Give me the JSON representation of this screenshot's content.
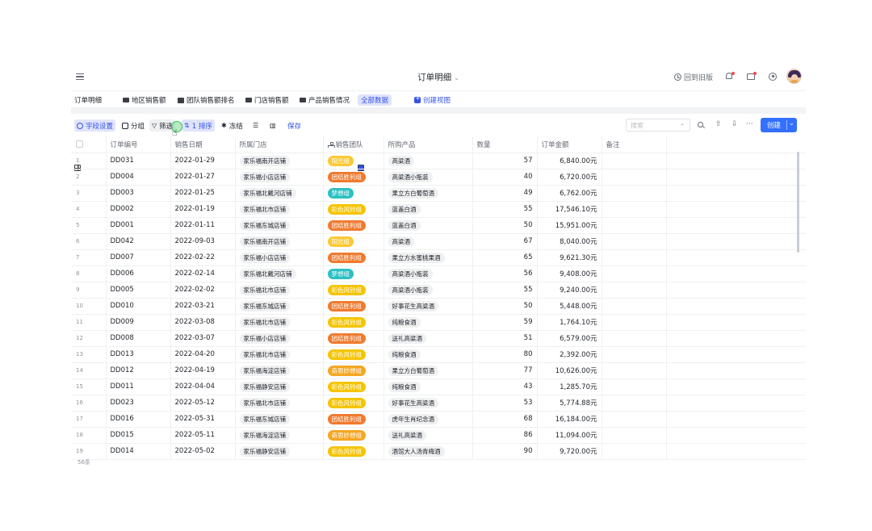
{
  "topbar": {
    "title": "订单明细",
    "title_chevron": "⌄",
    "back_old": "回到旧版"
  },
  "tabs": [
    {
      "label": "订单明细",
      "icon": "grid-table-icon"
    },
    {
      "label": "地区销售额",
      "icon": "folder-icon"
    },
    {
      "label": "团队销售额排名",
      "icon": "table-icon"
    },
    {
      "label": "门店销售额",
      "icon": "folder-icon"
    },
    {
      "label": "产品销售情况",
      "icon": "folder-icon"
    },
    {
      "label": "全部数据",
      "icon": "grid-view-icon",
      "active": true
    },
    {
      "label": "创建视图",
      "icon": "plus-icon"
    }
  ],
  "toolbar": {
    "field_settings": "字段设置",
    "group": "分组",
    "filter": "筛选",
    "sort": "1 排序",
    "freeze": "冻结",
    "save": "保存",
    "search_placeholder": "搜索",
    "create": "创建",
    "more": "···"
  },
  "table": {
    "headers": [
      "订单编号",
      "销售日期",
      "所属门店",
      "销售团队",
      "所购产品",
      "数量",
      "订单金额",
      "备注"
    ],
    "rows": [
      {
        "n": "1",
        "id": "DD031",
        "date": "2022-01-29",
        "store": "家乐福南开店铺",
        "team": "阳光组",
        "product": "高粱酒",
        "qty": "57",
        "amount": "6,840.00元"
      },
      {
        "n": "2",
        "id": "DD004",
        "date": "2022-01-27",
        "store": "家乐福小店店铺",
        "team": "团结胜利组",
        "product": "高粱酒小瓶装",
        "qty": "40",
        "amount": "6,720.00元"
      },
      {
        "n": "3",
        "id": "DD003",
        "date": "2022-01-25",
        "store": "家乐福北戴河店铺",
        "team": "梦想组",
        "product": "果立方白葡萄酒",
        "qty": "49",
        "amount": "6,762.00元"
      },
      {
        "n": "4",
        "id": "DD002",
        "date": "2022-01-19",
        "store": "家乐福北市店铺",
        "team": "彩色风铃组",
        "product": "蓝盖白酒",
        "qty": "55",
        "amount": "17,546.10元"
      },
      {
        "n": "5",
        "id": "DD001",
        "date": "2022-01-11",
        "store": "家乐福东城店铺",
        "team": "团结胜利组",
        "product": "蓝盖白酒",
        "qty": "50",
        "amount": "15,951.00元"
      },
      {
        "n": "6",
        "id": "DD042",
        "date": "2022-09-03",
        "store": "家乐福南开店铺",
        "team": "阳光组",
        "product": "高粱酒",
        "qty": "67",
        "amount": "8,040.00元"
      },
      {
        "n": "7",
        "id": "DD007",
        "date": "2022-02-22",
        "store": "家乐福小店店铺",
        "team": "团结胜利组",
        "product": "果立方水蜜桃果酒",
        "qty": "65",
        "amount": "9,621.30元"
      },
      {
        "n": "8",
        "id": "DD006",
        "date": "2022-02-14",
        "store": "家乐福北戴河店铺",
        "team": "梦想组",
        "product": "高粱酒小瓶装",
        "qty": "56",
        "amount": "9,408.00元"
      },
      {
        "n": "9",
        "id": "DD005",
        "date": "2022-02-02",
        "store": "家乐福北市店铺",
        "team": "彩色风铃组",
        "product": "高粱酒小瓶装",
        "qty": "55",
        "amount": "9,240.00元"
      },
      {
        "n": "10",
        "id": "DD010",
        "date": "2022-03-21",
        "store": "家乐福东城店铺",
        "team": "团结胜利组",
        "product": "好事花生高粱酒",
        "qty": "50",
        "amount": "5,448.00元"
      },
      {
        "n": "11",
        "id": "DD009",
        "date": "2022-03-08",
        "store": "家乐福北市店铺",
        "team": "彩色风铃组",
        "product": "纯粮食酒",
        "qty": "59",
        "amount": "1,764.10元"
      },
      {
        "n": "12",
        "id": "DD008",
        "date": "2022-03-07",
        "store": "家乐福小店店铺",
        "team": "团结胜利组",
        "product": "送礼高粱酒",
        "qty": "51",
        "amount": "6,579.00元"
      },
      {
        "n": "13",
        "id": "DD013",
        "date": "2022-04-20",
        "store": "家乐福北市店铺",
        "team": "彩色风铃组",
        "product": "纯粮食酒",
        "qty": "80",
        "amount": "2,392.00元"
      },
      {
        "n": "14",
        "id": "DD012",
        "date": "2022-04-19",
        "store": "家乐福海淀店铺",
        "team": "奇思妙想组",
        "product": "果立方白葡萄酒",
        "qty": "77",
        "amount": "10,626.00元"
      },
      {
        "n": "15",
        "id": "DD011",
        "date": "2022-04-04",
        "store": "家乐福静安店铺",
        "team": "彩色风铃组",
        "product": "纯粮食酒",
        "qty": "43",
        "amount": "1,285.70元"
      },
      {
        "n": "16",
        "id": "DD023",
        "date": "2022-05-12",
        "store": "家乐福北市店铺",
        "team": "彩色风铃组",
        "product": "好事花生高粱酒",
        "qty": "53",
        "amount": "5,774.88元"
      },
      {
        "n": "17",
        "id": "DD016",
        "date": "2022-05-31",
        "store": "家乐福东城店铺",
        "team": "团结胜利组",
        "product": "虎年生肖纪念酒",
        "qty": "68",
        "amount": "16,184.00元"
      },
      {
        "n": "18",
        "id": "DD015",
        "date": "2022-05-11",
        "store": "家乐福海淀店铺",
        "team": "奇思妙想组",
        "product": "送礼高粱酒",
        "qty": "86",
        "amount": "11,094.00元"
      },
      {
        "n": "19",
        "id": "DD014",
        "date": "2022-05-02",
        "store": "家乐福静安店铺",
        "team": "彩色风铃组",
        "product": "酒馆大人汤青梅酒",
        "qty": "90",
        "amount": "9,720.00元"
      }
    ],
    "record_count": "56条"
  },
  "team_colors": {
    "阳光组": "#fcc934",
    "团结胜利组": "#f07a2e",
    "梦想组": "#2bc0c4",
    "彩色风铃组": "#f5c400",
    "奇思妙想组": "#f5a623"
  }
}
